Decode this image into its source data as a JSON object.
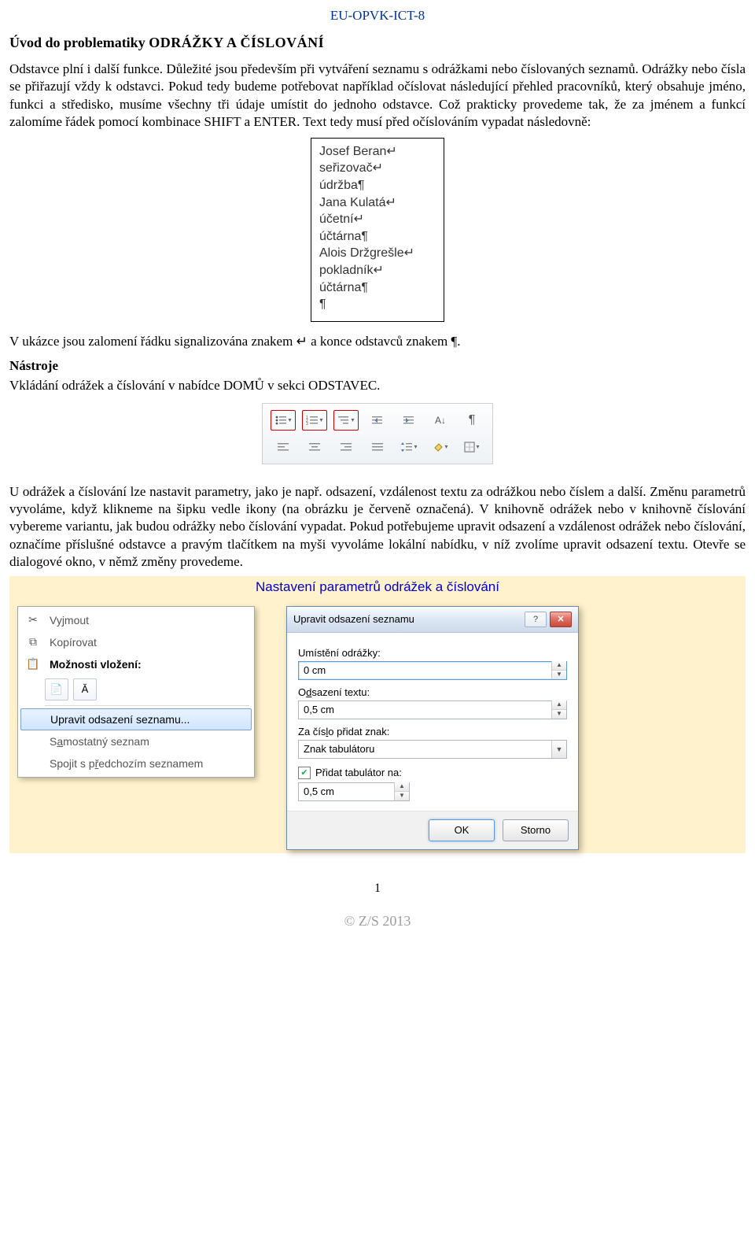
{
  "header_code": "EU-OPVK-ICT-8",
  "title_prefix": "Úvod do problematiky ",
  "title_caps": "ODRÁŽKY A ČÍSLOVÁNÍ",
  "para1": "Odstavce plní i další funkce. Důležité jsou především při vytváření seznamu s odrážkami nebo číslovaných seznamů. Odrážky nebo čísla se přiřazují vždy k odstavci. Pokud tedy budeme potřebovat například očíslovat následující přehled pracovníků, který obsahuje jméno, funkci a středisko, musíme všechny tři údaje umístit do jednoho odstavce. Což prakticky provedeme tak, že za jménem a funkcí zalomíme řádek pomocí kombinace SHIFT a ENTER. Text tedy musí před očíslováním vypadat následovně:",
  "sample_lines": [
    "Josef Beran↵",
    "seřizovač↵",
    "údržba¶",
    "Jana Kulatá↵",
    "účetní↵",
    "účtárna¶",
    "Alois Držgrešle↵",
    "pokladník↵",
    "účtárna¶",
    "¶"
  ],
  "para2_a": "V ukázce jsou zalomení řádku signalizována znakem ",
  "para2_b": " a konce odstavců znakem ¶.",
  "subhead_tools": "Nástroje",
  "tools_sentence_a": "Vkládání odrážek a číslování v nabídce ",
  "tools_sentence_b": " v sekci ",
  "tools_sentence_c": ".",
  "menu_domu": "DOMŮ",
  "menu_odstavec": "ODSTAVEC",
  "para3": "U odrážek a číslování lze nastavit parametry, jako je např. odsazení, vzdálenost textu za odrážkou nebo číslem a další. Změnu parametrů vyvoláme, když klikneme na šipku vedle ikony (na obrázku je červeně označená). V knihovně odrážek nebo v knihovně číslování vybereme variantu, jak budou odrážky nebo číslování vypadat. Pokud potřebujeme upravit odsazení a vzdálenost odrážek nebo číslování, označíme příslušné odstavce a pravým tlačítkem na myši vyvoláme lokální nabídku, v níž zvolíme upravit odsazení textu. Otevře se dialogové okno, v němž změny provedeme.",
  "yellow_title": "Nastavení parametrů odrážek a číslování",
  "ctx": {
    "cut": "Vyjmout",
    "copy": "Kopírovat",
    "paste_header": "Možnosti vložení:",
    "adjust": "Upravit odsazení seznamu...",
    "standalone_pre": "S",
    "standalone_ul": "a",
    "standalone_post": "mostatný seznam",
    "join_pre": "Spojit s p",
    "join_ul": "ř",
    "join_post": "edchozím seznamem"
  },
  "dialog": {
    "title": "Upravit odsazení seznamu",
    "lbl_pos": "Umístění odrážky:",
    "val_pos": "0 cm",
    "lbl_indent_pre": "O",
    "lbl_indent_ul": "d",
    "lbl_indent_post": "sazení textu:",
    "val_indent": "0,5 cm",
    "lbl_after_pre": "Za čís",
    "lbl_after_ul": "l",
    "lbl_after_post": "o přidat znak:",
    "val_after": "Znak tabulátoru",
    "chk_pre": "Přidat ",
    "chk_ul": "t",
    "chk_post": "abulátor na:",
    "val_tab": "0,5 cm",
    "ok": "OK",
    "cancel": "Storno"
  },
  "page_number": "1",
  "footer_org": "© Z/S 2013"
}
